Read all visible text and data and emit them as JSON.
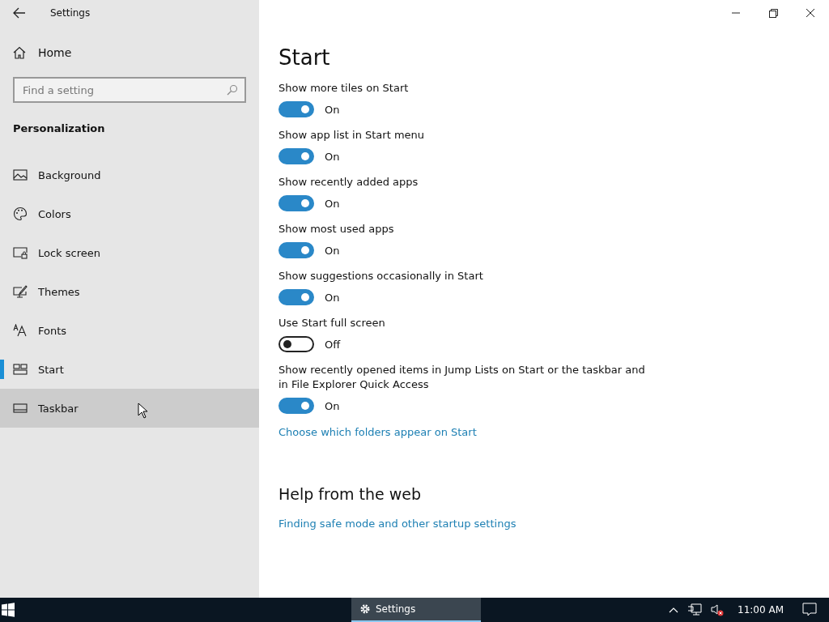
{
  "window": {
    "title": "Settings"
  },
  "sidebar": {
    "home": "Home",
    "search": {
      "placeholder": "Find a setting"
    },
    "section": "Personalization",
    "items": [
      {
        "label": "Background",
        "kind": "background",
        "selected": false,
        "hovered": false
      },
      {
        "label": "Colors",
        "kind": "colors",
        "selected": false,
        "hovered": false
      },
      {
        "label": "Lock screen",
        "kind": "lock",
        "selected": false,
        "hovered": false
      },
      {
        "label": "Themes",
        "kind": "themes",
        "selected": false,
        "hovered": false
      },
      {
        "label": "Fonts",
        "kind": "fonts",
        "selected": false,
        "hovered": false
      },
      {
        "label": "Start",
        "kind": "start",
        "selected": true,
        "hovered": false
      },
      {
        "label": "Taskbar",
        "kind": "taskbar",
        "selected": false,
        "hovered": true
      }
    ]
  },
  "page": {
    "title": "Start",
    "settings": [
      {
        "label": "Show more tiles on Start",
        "on": true,
        "state": "On"
      },
      {
        "label": "Show app list in Start menu",
        "on": true,
        "state": "On"
      },
      {
        "label": "Show recently added apps",
        "on": true,
        "state": "On"
      },
      {
        "label": "Show most used apps",
        "on": true,
        "state": "On"
      },
      {
        "label": "Show suggestions occasionally in Start",
        "on": true,
        "state": "On"
      },
      {
        "label": "Use Start full screen",
        "on": false,
        "state": "Off"
      },
      {
        "label": "Show recently opened items in Jump Lists on Start or the taskbar and in File Explorer Quick Access",
        "on": true,
        "state": "On"
      }
    ],
    "link": "Choose which folders appear on Start",
    "help": {
      "title": "Help from the web",
      "links": [
        "Finding safe mode and other startup settings"
      ]
    }
  },
  "taskbar": {
    "app": "Settings",
    "time": "11:00 AM"
  }
}
